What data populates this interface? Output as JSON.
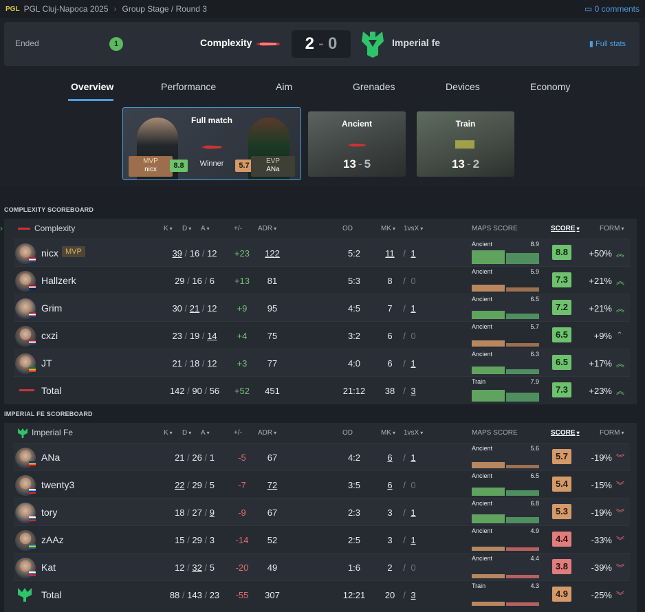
{
  "breadcrumb": {
    "logo": "PGL",
    "event": "PGL Cluj-Napoca 2025",
    "stage": "Group Stage / Round 3",
    "comments": "0 comments"
  },
  "match": {
    "status": "Ended",
    "badge": "1",
    "team1": "Complexity",
    "team2": "Imperial fe",
    "score1": "2",
    "score2": "0",
    "full_stats": "Full stats"
  },
  "tabs": [
    "Overview",
    "Performance",
    "Aim",
    "Grenades",
    "Devices",
    "Economy"
  ],
  "full_match": {
    "title": "Full match",
    "mvp_label": "MVP",
    "mvp_name": "nicx",
    "mvp_score": "8.8",
    "winner": "Winner",
    "evp_label": "EVP",
    "evp_name": "ANa",
    "evp_score": "5.7"
  },
  "map_cards": [
    {
      "name": "Ancient",
      "s1": "13",
      "s2": "5"
    },
    {
      "name": "Train",
      "s1": "13",
      "s2": "2"
    }
  ],
  "headers": {
    "k": "K",
    "d": "D",
    "a": "A",
    "pm": "+/-",
    "adr": "ADR",
    "od": "OD",
    "mk": "MK",
    "clutch": "1vsX",
    "maps": "MAPS SCORE",
    "score": "SCORE",
    "form": "FORM"
  },
  "complexity": {
    "title": "COMPLEXITY SCOREBOARD",
    "team": "Complexity",
    "players": [
      {
        "name": "nicx",
        "mvp": "MVP",
        "k": "39",
        "d": "16",
        "a": "12",
        "pm": "+23",
        "adr": "122",
        "od": "5:2",
        "mk": "11",
        "cl": "1",
        "map": "Ancient",
        "mscore": "8.9",
        "score": "8.8",
        "form": "+50%",
        "flag": "us"
      },
      {
        "name": "Hallzerk",
        "k": "29",
        "d": "16",
        "a": "6",
        "pm": "+13",
        "adr": "81",
        "od": "5:3",
        "mk": "8",
        "cl": "0",
        "map": "Ancient",
        "mscore": "5.9",
        "score": "7.3",
        "form": "+21%",
        "flag": "no"
      },
      {
        "name": "Grim",
        "k": "30",
        "d": "21",
        "a": "12",
        "pm": "+9",
        "adr": "95",
        "od": "4:5",
        "mk": "7",
        "cl": "1",
        "map": "Ancient",
        "mscore": "6.5",
        "score": "7.2",
        "form": "+21%",
        "flag": "us"
      },
      {
        "name": "cxzi",
        "k": "23",
        "d": "19",
        "a": "14",
        "pm": "+4",
        "adr": "75",
        "od": "3:2",
        "mk": "6",
        "cl": "0",
        "map": "Ancient",
        "mscore": "5.7",
        "score": "6.5",
        "form": "+9%",
        "flag": "us"
      },
      {
        "name": "JT",
        "k": "21",
        "d": "18",
        "a": "12",
        "pm": "+3",
        "adr": "77",
        "od": "4:0",
        "mk": "6",
        "cl": "1",
        "map": "Ancient",
        "mscore": "6.3",
        "score": "6.5",
        "form": "+17%",
        "flag": "za"
      }
    ],
    "total": {
      "name": "Total",
      "k": "142",
      "d": "90",
      "a": "56",
      "pm": "+52",
      "adr": "451",
      "od": "21:12",
      "mk": "38",
      "cl": "3",
      "map": "Train",
      "mscore": "7.9",
      "score": "7.3",
      "form": "+23%"
    }
  },
  "imperial": {
    "title": "IMPERIAL FE SCOREBOARD",
    "team": "Imperial Fe",
    "players": [
      {
        "name": "ANa",
        "k": "21",
        "d": "26",
        "a": "1",
        "pm": "-5",
        "adr": "67",
        "od": "4:2",
        "mk": "6",
        "cl": "1",
        "map": "Ancient",
        "mscore": "5.6",
        "score": "5.7",
        "form": "-19%",
        "flag": "ro"
      },
      {
        "name": "twenty3",
        "k": "22",
        "d": "29",
        "a": "5",
        "pm": "-7",
        "adr": "72",
        "od": "3:5",
        "mk": "6",
        "cl": "0",
        "map": "Ancient",
        "mscore": "6.5",
        "score": "5.4",
        "form": "-15%",
        "flag": "ru"
      },
      {
        "name": "tory",
        "k": "18",
        "d": "27",
        "a": "9",
        "pm": "-9",
        "adr": "67",
        "od": "2:3",
        "mk": "3",
        "cl": "1",
        "map": "Ancient",
        "mscore": "6.8",
        "score": "5.3",
        "form": "-19%",
        "flag": "ru"
      },
      {
        "name": "zAAz",
        "k": "15",
        "d": "29",
        "a": "3",
        "pm": "-14",
        "adr": "52",
        "od": "2:5",
        "mk": "3",
        "cl": "1",
        "map": "Ancient",
        "mscore": "4.9",
        "score": "4.4",
        "form": "-33%",
        "flag": "se"
      },
      {
        "name": "Kat",
        "k": "12",
        "d": "32",
        "a": "5",
        "pm": "-20",
        "adr": "49",
        "od": "1:6",
        "mk": "2",
        "cl": "0",
        "map": "Ancient",
        "mscore": "4.4",
        "score": "3.8",
        "form": "-39%",
        "flag": "sk"
      }
    ],
    "total": {
      "name": "Total",
      "k": "88",
      "d": "143",
      "a": "23",
      "pm": "-55",
      "adr": "307",
      "od": "12:21",
      "mk": "20",
      "cl": "3",
      "map": "Train",
      "mscore": "4.3",
      "score": "4.9",
      "form": "-25%"
    }
  }
}
